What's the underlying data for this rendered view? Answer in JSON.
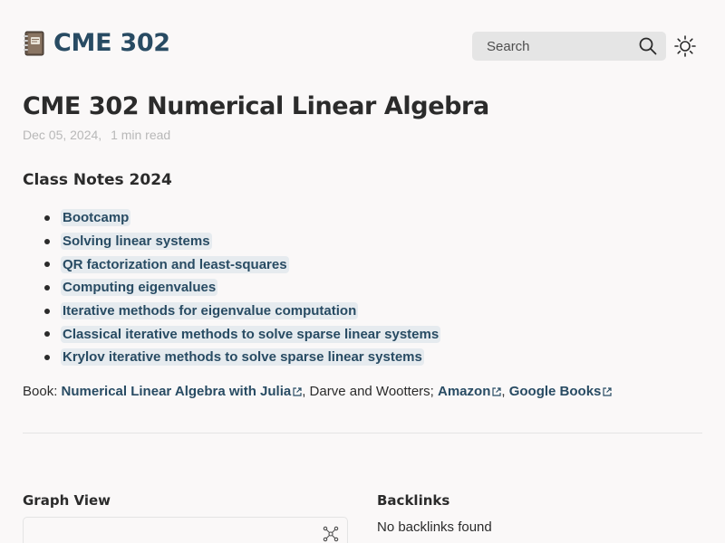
{
  "header": {
    "site_icon": "notebook-icon",
    "site_title": "CME 302",
    "search_placeholder": "Search",
    "search_icon": "search-icon",
    "theme_icon": "sun-icon"
  },
  "article": {
    "title": "CME 302 Numerical Linear Algebra",
    "date": "Dec 05, 2024,",
    "read_time": "1 min read",
    "section_heading": "Class Notes 2024",
    "notes": [
      "Bootcamp",
      "Solving linear systems",
      "QR factorization and least-squares",
      "Computing eigenvalues",
      "Iterative methods for eigenvalue computation",
      "Classical iterative methods to solve sparse linear systems",
      "Krylov iterative methods to solve sparse linear systems"
    ],
    "book": {
      "prefix": "Book: ",
      "title_link": "Numerical Linear Algebra with Julia",
      "authors": ", Darve and Wootters; ",
      "amazon_link": "Amazon",
      "separator": ", ",
      "google_link": "Google Books",
      "external_icon": "external-link-icon"
    }
  },
  "footer": {
    "graph_heading": "Graph View",
    "graph_icon": "graph-expand-icon",
    "backlinks_heading": "Backlinks",
    "backlinks_empty": "No backlinks found"
  },
  "colors": {
    "background": "#faf8f8",
    "accent": "#284b63",
    "link_highlight": "#e6ebef",
    "muted_text": "#b8b8b8"
  }
}
